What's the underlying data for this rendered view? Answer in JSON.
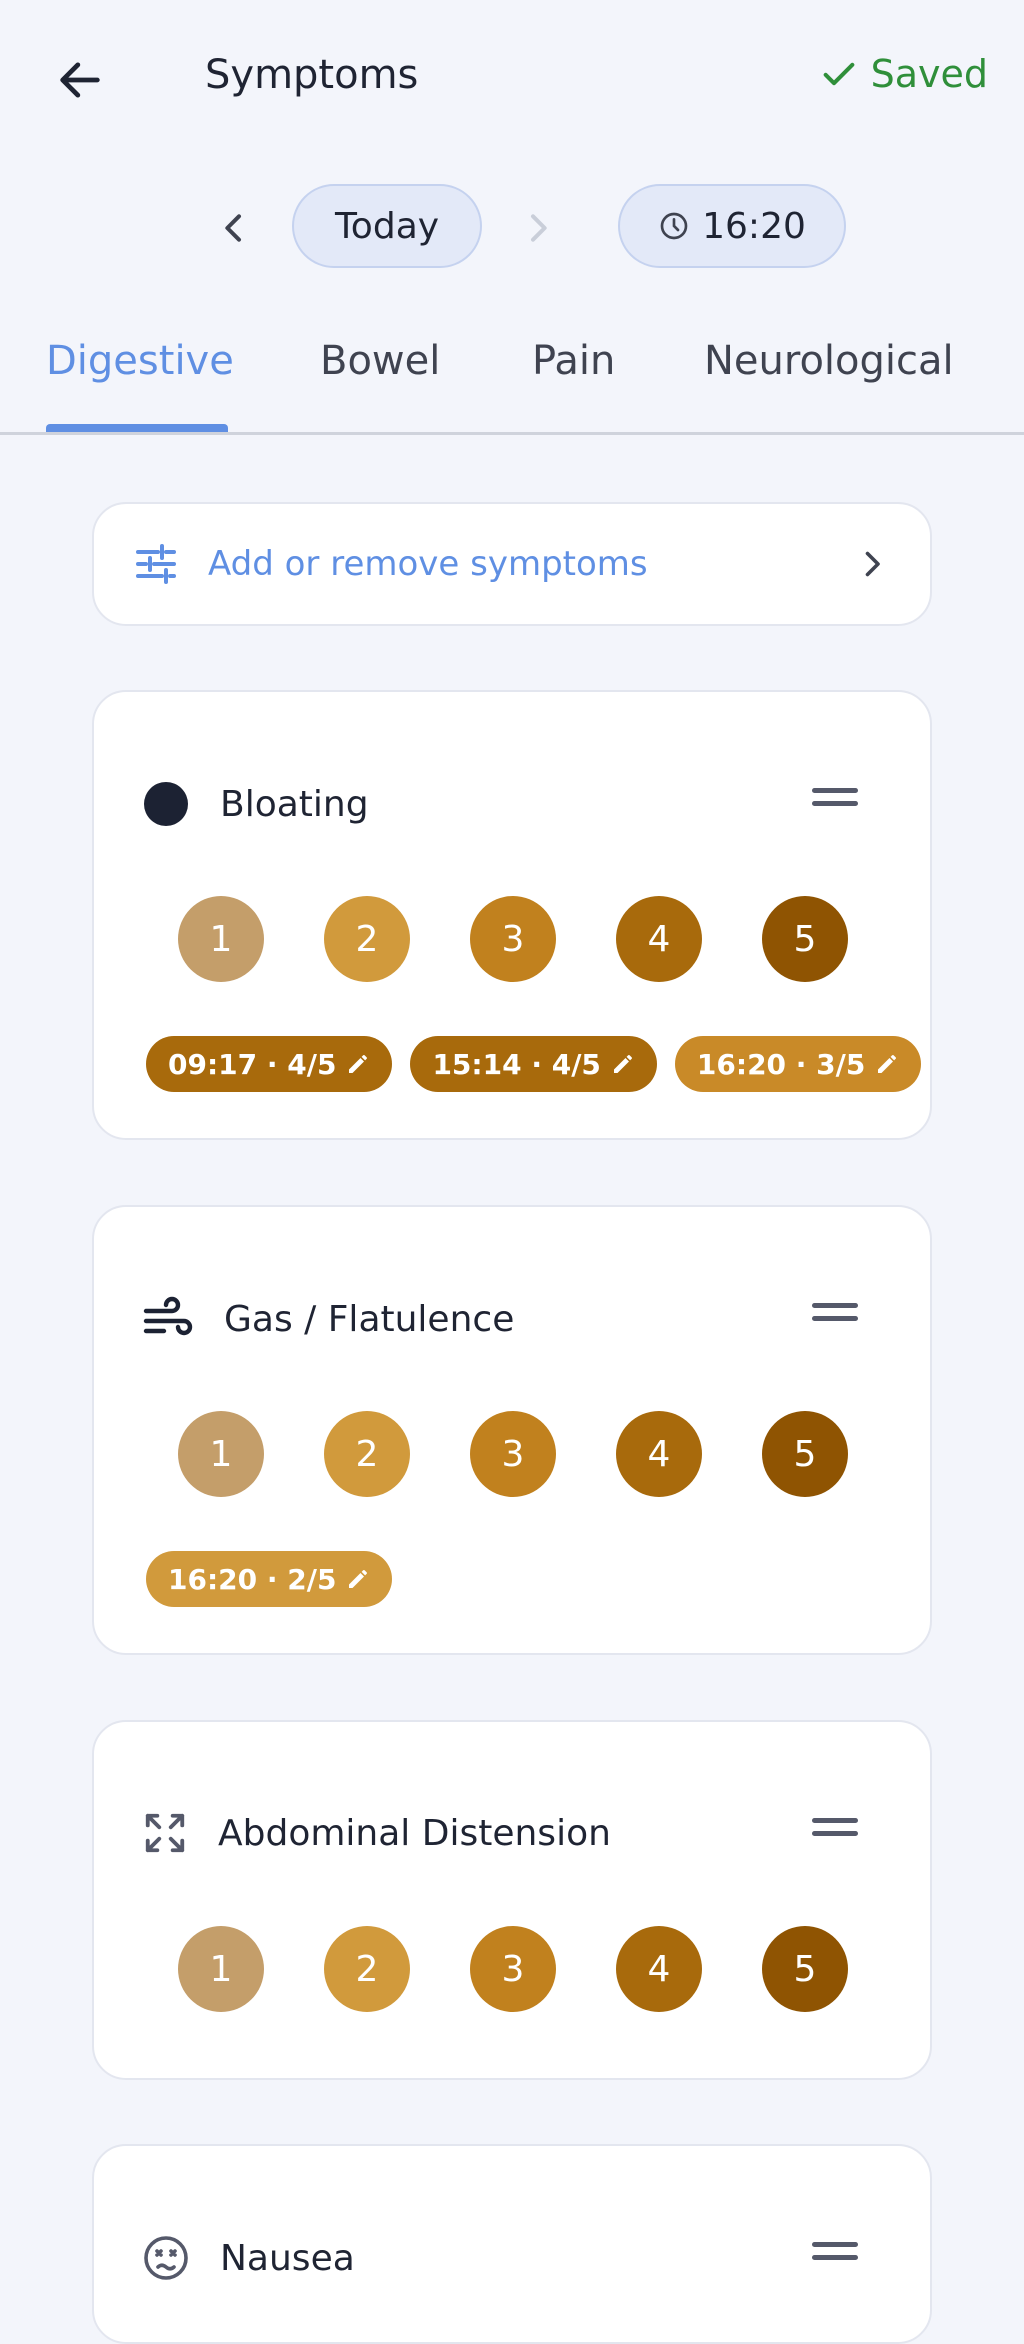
{
  "header": {
    "title": "Symptoms",
    "saved_label": "Saved"
  },
  "date_nav": {
    "date_label": "Today",
    "time_label": "16:20"
  },
  "tabs": [
    {
      "label": "Digestive",
      "active": true
    },
    {
      "label": "Bowel",
      "active": false
    },
    {
      "label": "Pain",
      "active": false
    },
    {
      "label": "Neurological",
      "active": false
    }
  ],
  "add_remove": {
    "label": "Add or remove symptoms"
  },
  "severity_levels": [
    "1",
    "2",
    "3",
    "4",
    "5"
  ],
  "colors": {
    "accent": "#5f8fe3",
    "saved": "#2f8f3a",
    "level_1": "#c49e6a",
    "level_2": "#d19a3c",
    "level_3": "#c1811e",
    "level_4": "#a86a0c",
    "level_5": "#8f5402"
  },
  "symptoms": [
    {
      "name": "Bloating",
      "icon": "filled-circle-icon",
      "entries": [
        {
          "label": "09:17 · 4/5",
          "level": 4
        },
        {
          "label": "15:14 · 4/5",
          "level": 4
        },
        {
          "label": "16:20 · 3/5",
          "level": 3
        }
      ]
    },
    {
      "name": "Gas / Flatulence",
      "icon": "wind-icon",
      "entries": [
        {
          "label": "16:20 · 2/5",
          "level": 2
        }
      ]
    },
    {
      "name": "Abdominal Distension",
      "icon": "expand-icon",
      "entries": []
    },
    {
      "name": "Nausea",
      "icon": "sick-face-icon",
      "entries": []
    }
  ]
}
